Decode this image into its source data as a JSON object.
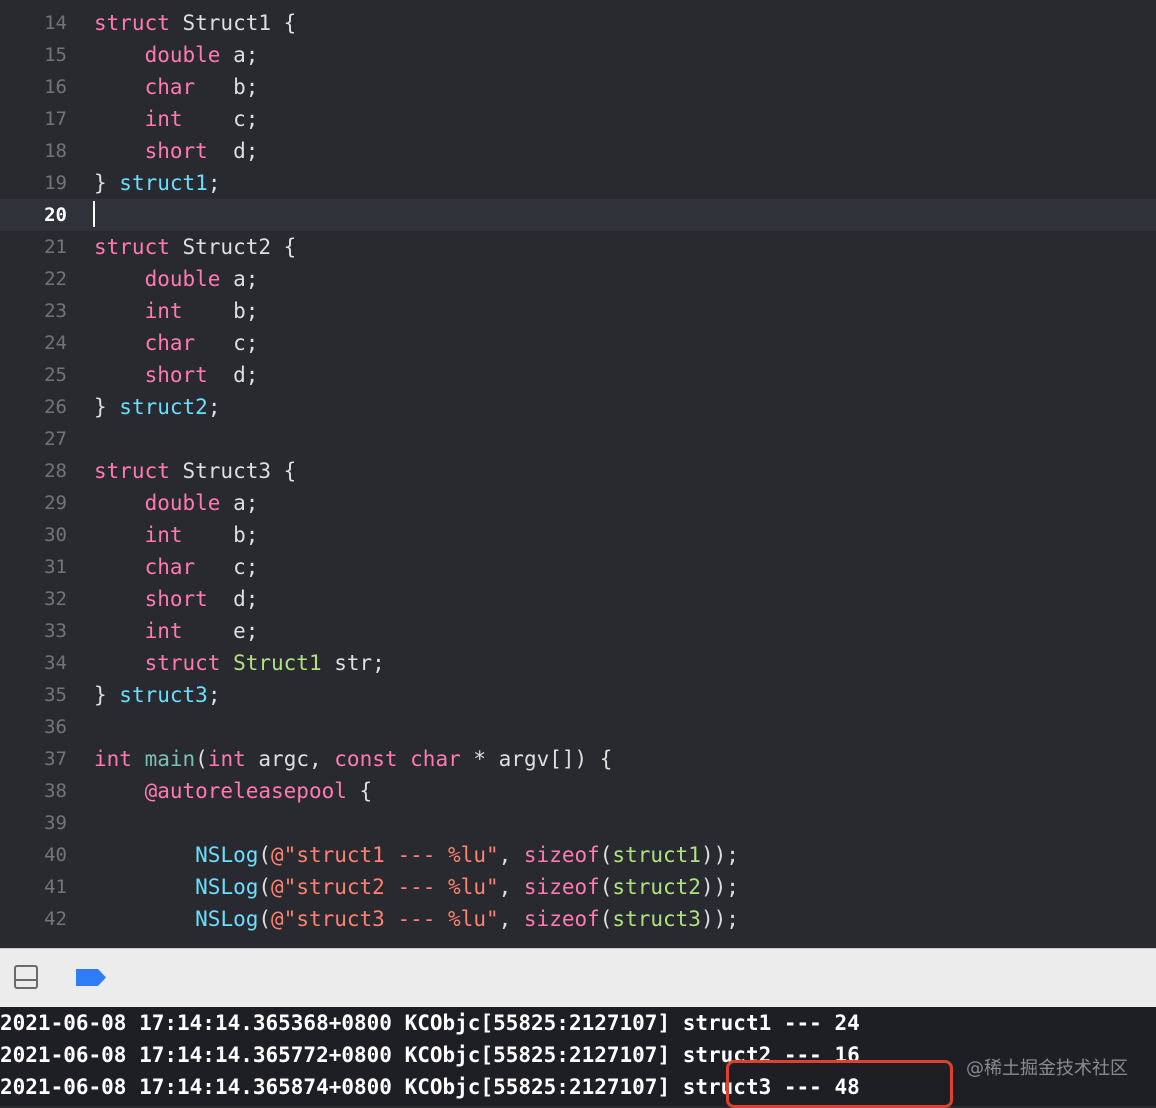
{
  "editor": {
    "lines": [
      {
        "num": "14",
        "tokens": [
          {
            "t": "struct",
            "c": "t-kw"
          },
          {
            "t": " Struct1 {",
            "c": "plain"
          }
        ]
      },
      {
        "num": "15",
        "tokens": [
          {
            "t": "    ",
            "c": "plain"
          },
          {
            "t": "double",
            "c": "t-kw"
          },
          {
            "t": " a;",
            "c": "plain"
          }
        ]
      },
      {
        "num": "16",
        "tokens": [
          {
            "t": "    ",
            "c": "plain"
          },
          {
            "t": "char",
            "c": "t-kw"
          },
          {
            "t": "   b;",
            "c": "plain"
          }
        ]
      },
      {
        "num": "17",
        "tokens": [
          {
            "t": "    ",
            "c": "plain"
          },
          {
            "t": "int",
            "c": "t-kw"
          },
          {
            "t": "    c;",
            "c": "plain"
          }
        ]
      },
      {
        "num": "18",
        "tokens": [
          {
            "t": "    ",
            "c": "plain"
          },
          {
            "t": "short",
            "c": "t-kw"
          },
          {
            "t": "  d;",
            "c": "plain"
          }
        ]
      },
      {
        "num": "19",
        "tokens": [
          {
            "t": "} ",
            "c": "plain"
          },
          {
            "t": "struct1",
            "c": "t-var"
          },
          {
            "t": ";",
            "c": "plain"
          }
        ]
      },
      {
        "num": "20",
        "tokens": [],
        "current": true
      },
      {
        "num": "21",
        "tokens": [
          {
            "t": "struct",
            "c": "t-kw"
          },
          {
            "t": " Struct2 {",
            "c": "plain"
          }
        ]
      },
      {
        "num": "22",
        "tokens": [
          {
            "t": "    ",
            "c": "plain"
          },
          {
            "t": "double",
            "c": "t-kw"
          },
          {
            "t": " a;",
            "c": "plain"
          }
        ]
      },
      {
        "num": "23",
        "tokens": [
          {
            "t": "    ",
            "c": "plain"
          },
          {
            "t": "int",
            "c": "t-kw"
          },
          {
            "t": "    b;",
            "c": "plain"
          }
        ]
      },
      {
        "num": "24",
        "tokens": [
          {
            "t": "    ",
            "c": "plain"
          },
          {
            "t": "char",
            "c": "t-kw"
          },
          {
            "t": "   c;",
            "c": "plain"
          }
        ]
      },
      {
        "num": "25",
        "tokens": [
          {
            "t": "    ",
            "c": "plain"
          },
          {
            "t": "short",
            "c": "t-kw"
          },
          {
            "t": "  d;",
            "c": "plain"
          }
        ]
      },
      {
        "num": "26",
        "tokens": [
          {
            "t": "} ",
            "c": "plain"
          },
          {
            "t": "struct2",
            "c": "t-var"
          },
          {
            "t": ";",
            "c": "plain"
          }
        ]
      },
      {
        "num": "27",
        "tokens": []
      },
      {
        "num": "28",
        "tokens": [
          {
            "t": "struct",
            "c": "t-kw"
          },
          {
            "t": " Struct3 {",
            "c": "plain"
          }
        ]
      },
      {
        "num": "29",
        "tokens": [
          {
            "t": "    ",
            "c": "plain"
          },
          {
            "t": "double",
            "c": "t-kw"
          },
          {
            "t": " a;",
            "c": "plain"
          }
        ]
      },
      {
        "num": "30",
        "tokens": [
          {
            "t": "    ",
            "c": "plain"
          },
          {
            "t": "int",
            "c": "t-kw"
          },
          {
            "t": "    b;",
            "c": "plain"
          }
        ]
      },
      {
        "num": "31",
        "tokens": [
          {
            "t": "    ",
            "c": "plain"
          },
          {
            "t": "char",
            "c": "t-kw"
          },
          {
            "t": "   c;",
            "c": "plain"
          }
        ]
      },
      {
        "num": "32",
        "tokens": [
          {
            "t": "    ",
            "c": "plain"
          },
          {
            "t": "short",
            "c": "t-kw"
          },
          {
            "t": "  d;",
            "c": "plain"
          }
        ]
      },
      {
        "num": "33",
        "tokens": [
          {
            "t": "    ",
            "c": "plain"
          },
          {
            "t": "int",
            "c": "t-kw"
          },
          {
            "t": "    e;",
            "c": "plain"
          }
        ]
      },
      {
        "num": "34",
        "tokens": [
          {
            "t": "    ",
            "c": "plain"
          },
          {
            "t": "struct",
            "c": "t-kw"
          },
          {
            "t": " ",
            "c": "plain"
          },
          {
            "t": "Struct1",
            "c": "t-struct"
          },
          {
            "t": " str;",
            "c": "plain"
          }
        ]
      },
      {
        "num": "35",
        "tokens": [
          {
            "t": "} ",
            "c": "plain"
          },
          {
            "t": "struct3",
            "c": "t-var"
          },
          {
            "t": ";",
            "c": "plain"
          }
        ]
      },
      {
        "num": "36",
        "tokens": []
      },
      {
        "num": "37",
        "tokens": [
          {
            "t": "int",
            "c": "t-kw"
          },
          {
            "t": " ",
            "c": "plain"
          },
          {
            "t": "main",
            "c": "t-fn"
          },
          {
            "t": "(",
            "c": "plain"
          },
          {
            "t": "int",
            "c": "t-kw"
          },
          {
            "t": " argc, ",
            "c": "plain"
          },
          {
            "t": "const",
            "c": "t-kw"
          },
          {
            "t": " ",
            "c": "plain"
          },
          {
            "t": "char",
            "c": "t-kw"
          },
          {
            "t": " * argv[]) {",
            "c": "plain"
          }
        ]
      },
      {
        "num": "38",
        "tokens": [
          {
            "t": "    ",
            "c": "plain"
          },
          {
            "t": "@autoreleasepool",
            "c": "t-kw"
          },
          {
            "t": " {",
            "c": "plain"
          }
        ]
      },
      {
        "num": "39",
        "tokens": []
      },
      {
        "num": "40",
        "tokens": [
          {
            "t": "        ",
            "c": "plain"
          },
          {
            "t": "NSLog",
            "c": "t-var"
          },
          {
            "t": "(",
            "c": "plain"
          },
          {
            "t": "@\"struct1 --- %lu\"",
            "c": "t-str"
          },
          {
            "t": ", ",
            "c": "plain"
          },
          {
            "t": "sizeof",
            "c": "t-kw"
          },
          {
            "t": "(",
            "c": "plain"
          },
          {
            "t": "struct1",
            "c": "t-struct"
          },
          {
            "t": "));",
            "c": "plain"
          }
        ]
      },
      {
        "num": "41",
        "tokens": [
          {
            "t": "        ",
            "c": "plain"
          },
          {
            "t": "NSLog",
            "c": "t-var"
          },
          {
            "t": "(",
            "c": "plain"
          },
          {
            "t": "@\"struct2 --- %lu\"",
            "c": "t-str"
          },
          {
            "t": ", ",
            "c": "plain"
          },
          {
            "t": "sizeof",
            "c": "t-kw"
          },
          {
            "t": "(",
            "c": "plain"
          },
          {
            "t": "struct2",
            "c": "t-struct"
          },
          {
            "t": "));",
            "c": "plain"
          }
        ]
      },
      {
        "num": "42",
        "tokens": [
          {
            "t": "        ",
            "c": "plain"
          },
          {
            "t": "NSLog",
            "c": "t-var"
          },
          {
            "t": "(",
            "c": "plain"
          },
          {
            "t": "@\"struct3 --- %lu\"",
            "c": "t-str"
          },
          {
            "t": ", ",
            "c": "plain"
          },
          {
            "t": "sizeof",
            "c": "t-kw"
          },
          {
            "t": "(",
            "c": "plain"
          },
          {
            "t": "struct3",
            "c": "t-struct"
          },
          {
            "t": "));",
            "c": "plain"
          }
        ]
      }
    ]
  },
  "debugbar": {
    "panel_icon": "bottom-panel-toggle-icon",
    "breakpoint_icon": "breakpoint-toggle-icon",
    "accent": "#2f7cf6"
  },
  "console": {
    "lines": [
      "2021-06-08 17:14:14.365368+0800 KCObjc[55825:2127107] struct1 --- 24",
      "2021-06-08 17:14:14.365772+0800 KCObjc[55825:2127107] struct2 --- 16",
      "2021-06-08 17:14:14.365874+0800 KCObjc[55825:2127107] struct3 --- 48"
    ]
  },
  "watermark": "@稀土掘金技术社区",
  "highlight_color": "#e0412f"
}
